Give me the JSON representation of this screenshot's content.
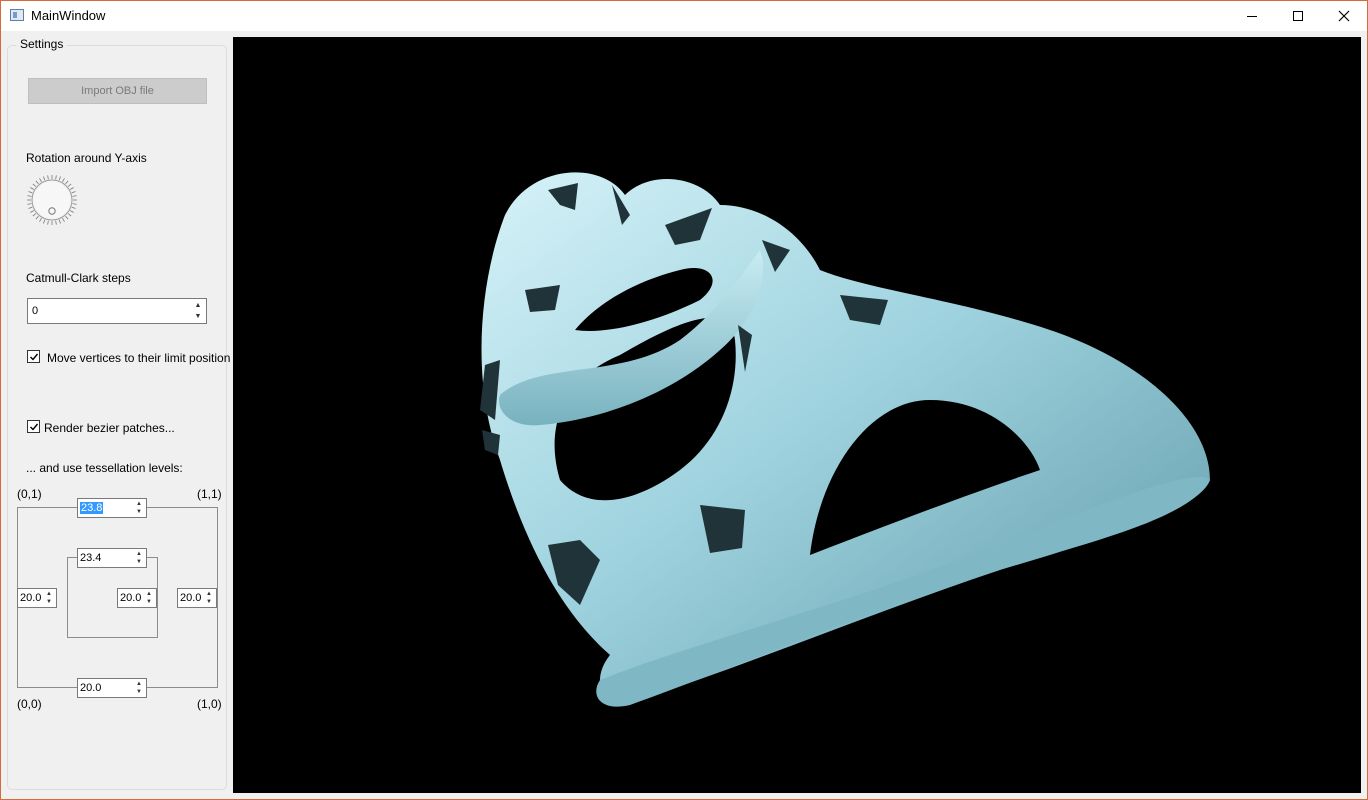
{
  "window": {
    "title": "MainWindow"
  },
  "settings": {
    "group_title": "Settings",
    "import_button": "Import OBJ file",
    "rotation_label": "Rotation around Y-axis",
    "catmull_label": "Catmull-Clark steps",
    "catmull_value": "0",
    "limit_position_label": "Move vertices to their limit position",
    "limit_position_checked": true,
    "bezier_label": "Render bezier patches...",
    "bezier_checked": true,
    "tess_label": "... and use tessellation levels:"
  },
  "tessellation": {
    "corner_tl": "(0,1)",
    "corner_tr": "(1,1)",
    "corner_bl": "(0,0)",
    "corner_br": "(1,0)",
    "outer_top": "23.8",
    "inner_top": "23.4",
    "outer_left": "20.0",
    "inner_right": "20.0",
    "outer_right": "20.0",
    "outer_bottom": "20.0"
  },
  "colors": {
    "model": "#9fd3df",
    "viewport_bg": "#000000",
    "selection": "#3399ff"
  }
}
